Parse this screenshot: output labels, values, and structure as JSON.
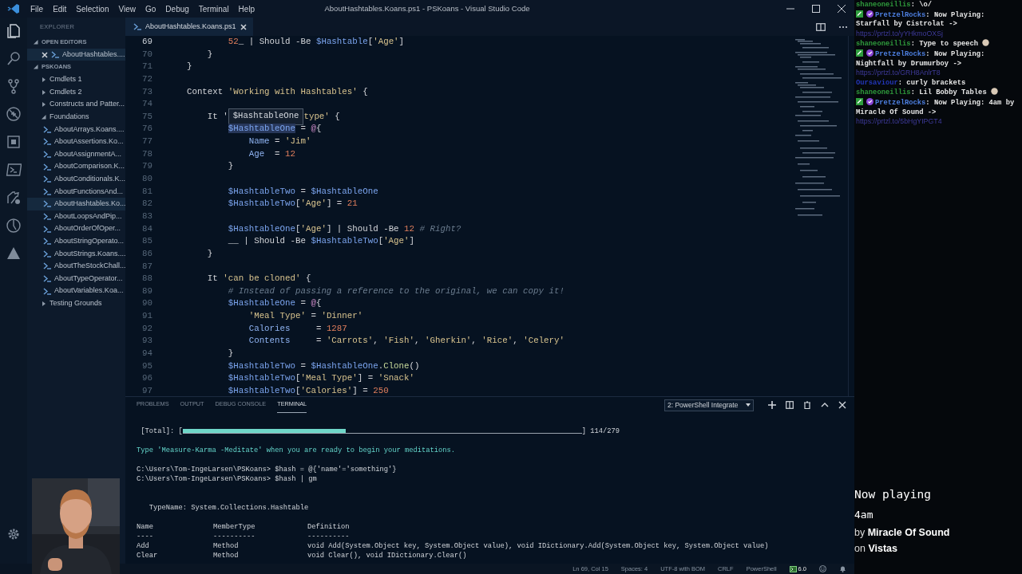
{
  "window": {
    "title": "AboutHashtables.Koans.ps1 - PSKoans - Visual Studio Code"
  },
  "menu": [
    "File",
    "Edit",
    "Selection",
    "View",
    "Go",
    "Debug",
    "Terminal",
    "Help"
  ],
  "sidebar": {
    "title": "EXPLORER",
    "sections": [
      {
        "title": "OPEN EDITORS",
        "expanded": true,
        "items": [
          {
            "label": "AboutHashtables....",
            "kind": "open-file",
            "selected": true
          }
        ]
      },
      {
        "title": "PSKOANS",
        "expanded": true,
        "items": [
          {
            "label": "Cmdlets 1",
            "kind": "folder",
            "expanded": false,
            "selected": false
          },
          {
            "label": "Cmdlets 2",
            "kind": "folder",
            "expanded": false,
            "selected": false
          },
          {
            "label": "Constructs and Patter...",
            "kind": "folder",
            "expanded": false,
            "selected": false
          },
          {
            "label": "Foundations",
            "kind": "folder",
            "expanded": true,
            "selected": false,
            "children": [
              {
                "label": "AboutArrays.Koans....",
                "kind": "file",
                "selected": false
              },
              {
                "label": "AboutAssertions.Ko...",
                "kind": "file",
                "selected": false
              },
              {
                "label": "AboutAssignmentA...",
                "kind": "file",
                "selected": false
              },
              {
                "label": "AboutComparison.K...",
                "kind": "file",
                "selected": false
              },
              {
                "label": "AboutConditionals.K...",
                "kind": "file",
                "selected": false
              },
              {
                "label": "AboutFunctionsAnd...",
                "kind": "file",
                "selected": false
              },
              {
                "label": "AboutHashtables.Ko...",
                "kind": "file",
                "selected": true
              },
              {
                "label": "AboutLoopsAndPip...",
                "kind": "file",
                "selected": false
              },
              {
                "label": "AboutOrderOfOper...",
                "kind": "file",
                "selected": false
              },
              {
                "label": "AboutStringOperato...",
                "kind": "file",
                "selected": false
              },
              {
                "label": "AboutStrings.Koans....",
                "kind": "file",
                "selected": false
              },
              {
                "label": "AboutTheStockChall...",
                "kind": "file",
                "selected": false
              },
              {
                "label": "AboutTypeOperator...",
                "kind": "file",
                "selected": false
              },
              {
                "label": "AboutVariables.Koa...",
                "kind": "file",
                "selected": false
              }
            ]
          },
          {
            "label": "Testing Grounds",
            "kind": "folder",
            "expanded": false,
            "selected": false
          }
        ]
      }
    ]
  },
  "tabs": [
    {
      "label": "AboutHashtables.Koans.ps1",
      "selected": true
    }
  ],
  "code_lines": [
    {
      "number": "69",
      "current": true,
      "tokens": [
        {
          "text": "            52",
          "kind": "num"
        },
        {
          "text": "_ | Should -Be ",
          "kind": "plain"
        },
        {
          "text": "$Hashtable",
          "kind": "var"
        },
        {
          "text": "[",
          "kind": "plain"
        },
        {
          "text": "'Age'",
          "kind": "str"
        },
        {
          "text": "]",
          "kind": "plain"
        }
      ]
    },
    {
      "number": "70",
      "current": false,
      "tokens": [
        {
          "text": "        }",
          "kind": "plain"
        }
      ]
    },
    {
      "number": "71",
      "current": false,
      "tokens": [
        {
          "text": "    }",
          "kind": "plain"
        }
      ]
    },
    {
      "number": "72",
      "current": false
    },
    {
      "number": "73",
      "current": false,
      "tokens": [
        {
          "text": "    Context ",
          "kind": "plain"
        },
        {
          "text": "'Working with Hashtables'",
          "kind": "str"
        },
        {
          "text": " {",
          "kind": "plain"
        }
      ]
    },
    {
      "number": "74",
      "current": false
    },
    {
      "number": "75",
      "current": false,
      "tokens": [
        {
          "text": "        It '",
          "kind": "plain"
        },
        {
          "text": "$HashtableOne",
          "kind": "tooltip"
        },
        {
          "text": "type'",
          "kind": "str"
        },
        {
          "text": " {",
          "kind": "plain"
        }
      ]
    },
    {
      "number": "76",
      "current": false,
      "tokens": [
        {
          "text": "            $HashtableOne",
          "kind": "selected"
        },
        {
          "text": " = ",
          "kind": "plain"
        },
        {
          "text": "@",
          "kind": "at"
        },
        {
          "text": "{",
          "kind": "plain"
        }
      ]
    },
    {
      "number": "77",
      "current": false,
      "tokens": [
        {
          "text": "                Name",
          "kind": "prop"
        },
        {
          "text": " = ",
          "kind": "plain"
        },
        {
          "text": "'Jim'",
          "kind": "str"
        }
      ]
    },
    {
      "number": "78",
      "current": false,
      "tokens": [
        {
          "text": "                Age",
          "kind": "prop"
        },
        {
          "text": "  = ",
          "kind": "plain"
        },
        {
          "text": "12",
          "kind": "num"
        }
      ]
    },
    {
      "number": "79",
      "current": false,
      "tokens": [
        {
          "text": "            }",
          "kind": "plain"
        }
      ]
    },
    {
      "number": "80",
      "current": false
    },
    {
      "number": "81",
      "current": false,
      "tokens": [
        {
          "text": "            $HashtableTwo",
          "kind": "var"
        },
        {
          "text": " = ",
          "kind": "plain"
        },
        {
          "text": "$HashtableOne",
          "kind": "var"
        }
      ]
    },
    {
      "number": "82",
      "current": false,
      "tokens": [
        {
          "text": "            $HashtableTwo",
          "kind": "var"
        },
        {
          "text": "[",
          "kind": "plain"
        },
        {
          "text": "'Age'",
          "kind": "str"
        },
        {
          "text": "] = ",
          "kind": "plain"
        },
        {
          "text": "21",
          "kind": "num"
        }
      ]
    },
    {
      "number": "83",
      "current": false
    },
    {
      "number": "84",
      "current": false,
      "tokens": [
        {
          "text": "            $HashtableOne",
          "kind": "var"
        },
        {
          "text": "[",
          "kind": "plain"
        },
        {
          "text": "'Age'",
          "kind": "str"
        },
        {
          "text": "] | Should -Be ",
          "kind": "plain"
        },
        {
          "text": "12",
          "kind": "num"
        },
        {
          "text": " # Right?",
          "kind": "comment"
        }
      ]
    },
    {
      "number": "85",
      "current": false,
      "tokens": [
        {
          "text": "            __ | Should -Be ",
          "kind": "plain"
        },
        {
          "text": "$HashtableTwo",
          "kind": "var"
        },
        {
          "text": "[",
          "kind": "plain"
        },
        {
          "text": "'Age'",
          "kind": "str"
        },
        {
          "text": "]",
          "kind": "plain"
        }
      ]
    },
    {
      "number": "86",
      "current": false,
      "tokens": [
        {
          "text": "        }",
          "kind": "plain"
        }
      ]
    },
    {
      "number": "87",
      "current": false
    },
    {
      "number": "88",
      "current": false,
      "tokens": [
        {
          "text": "        It ",
          "kind": "plain"
        },
        {
          "text": "'can be cloned'",
          "kind": "str"
        },
        {
          "text": " {",
          "kind": "plain"
        }
      ]
    },
    {
      "number": "89",
      "current": false,
      "tokens": [
        {
          "text": "            # Instead of passing a reference to the original, we can copy it!",
          "kind": "comment"
        }
      ]
    },
    {
      "number": "90",
      "current": false,
      "tokens": [
        {
          "text": "            $HashtableOne",
          "kind": "var"
        },
        {
          "text": " = ",
          "kind": "plain"
        },
        {
          "text": "@",
          "kind": "at"
        },
        {
          "text": "{",
          "kind": "plain"
        }
      ]
    },
    {
      "number": "91",
      "current": false,
      "tokens": [
        {
          "text": "                'Meal Type'",
          "kind": "str"
        },
        {
          "text": " = ",
          "kind": "plain"
        },
        {
          "text": "'Dinner'",
          "kind": "str"
        }
      ]
    },
    {
      "number": "92",
      "current": false,
      "tokens": [
        {
          "text": "                Calories",
          "kind": "prop"
        },
        {
          "text": "     = ",
          "kind": "plain"
        },
        {
          "text": "1287",
          "kind": "num"
        }
      ]
    },
    {
      "number": "93",
      "current": false,
      "tokens": [
        {
          "text": "                Contents",
          "kind": "prop"
        },
        {
          "text": "     = ",
          "kind": "plain"
        },
        {
          "text": "'Carrots'",
          "kind": "str"
        },
        {
          "text": ", ",
          "kind": "plain"
        },
        {
          "text": "'Fish'",
          "kind": "str"
        },
        {
          "text": ", ",
          "kind": "plain"
        },
        {
          "text": "'Gherkin'",
          "kind": "str"
        },
        {
          "text": ", ",
          "kind": "plain"
        },
        {
          "text": "'Rice'",
          "kind": "str"
        },
        {
          "text": ", ",
          "kind": "plain"
        },
        {
          "text": "'Celery'",
          "kind": "str"
        }
      ]
    },
    {
      "number": "94",
      "current": false,
      "tokens": [
        {
          "text": "            }",
          "kind": "plain"
        }
      ]
    },
    {
      "number": "95",
      "current": false,
      "tokens": [
        {
          "text": "            $HashtableTwo",
          "kind": "var"
        },
        {
          "text": " = ",
          "kind": "plain"
        },
        {
          "text": "$HashtableOne",
          "kind": "var"
        },
        {
          "text": ".",
          "kind": "plain"
        },
        {
          "text": "Clone",
          "kind": "fn"
        },
        {
          "text": "()",
          "kind": "plain"
        }
      ]
    },
    {
      "number": "96",
      "current": false,
      "tokens": [
        {
          "text": "            $HashtableTwo",
          "kind": "var"
        },
        {
          "text": "[",
          "kind": "plain"
        },
        {
          "text": "'Meal Type'",
          "kind": "str"
        },
        {
          "text": "] = ",
          "kind": "plain"
        },
        {
          "text": "'Snack'",
          "kind": "str"
        }
      ]
    },
    {
      "number": "97",
      "current": false,
      "tokens": [
        {
          "text": "            $HashtableTwo",
          "kind": "var"
        },
        {
          "text": "[",
          "kind": "plain"
        },
        {
          "text": "'Calories'",
          "kind": "str"
        },
        {
          "text": "] = ",
          "kind": "plain"
        },
        {
          "text": "250",
          "kind": "num"
        }
      ]
    }
  ],
  "panel": {
    "tabs": [
      {
        "label": "PROBLEMS",
        "selected": false
      },
      {
        "label": "OUTPUT",
        "selected": false
      },
      {
        "label": "DEBUG CONSOLE",
        "selected": false
      },
      {
        "label": "TERMINAL",
        "selected": true
      }
    ],
    "terminal_select": "2: PowerShell Integrate",
    "terminal": {
      "progress": {
        "label": "[Total]: [",
        "level": 0.408,
        "reading": "] 114/279"
      },
      "message": "Type 'Measure-Karma -Meditate' when you are ready to begin your meditations.",
      "commands": [
        "C:\\Users\\Tom-IngeLarsen\\PSKoans> $hash = @{'name'='something'}",
        "C:\\Users\\Tom-IngeLarsen\\PSKoans> $hash | gm"
      ],
      "typename": "TypeName: System.Collections.Hashtable",
      "table": {
        "columns": [
          "Name",
          "MemberType",
          "Definition"
        ],
        "rules": [
          "----",
          "----------",
          "----------"
        ],
        "rows": [
          [
            "Add",
            "Method",
            "void Add(System.Object key, System.Object value), void IDictionary.Add(System.Object key, System.Object value)"
          ],
          [
            "Clear",
            "Method",
            "void Clear(), void IDictionary.Clear()"
          ]
        ]
      }
    }
  },
  "status_bar": [
    {
      "text": "Ln 69, Col 15",
      "kind": "text"
    },
    {
      "text": "Spaces: 4",
      "kind": "text"
    },
    {
      "text": "UTF-8 with BOM",
      "kind": "text"
    },
    {
      "text": "CRLF",
      "kind": "text"
    },
    {
      "text": "PowerShell",
      "kind": "text"
    },
    {
      "text": "6.0",
      "kind": "version"
    }
  ],
  "chat": [
    {
      "user": "shaneoneillis",
      "color": "#2f9a3c",
      "badges": false,
      "emoji": false,
      "text": ": \\o/"
    },
    {
      "user": "PretzelRocks",
      "color": "#4d7fe0",
      "badges": true,
      "emoji": false,
      "text": ": Now Playing: Starfall by Cistrolat -> ",
      "link": "https://prtzl.to/yYHkmoOXSj"
    },
    {
      "user": "shaneoneillis",
      "color": "#2f9a3c",
      "badges": false,
      "text": ": Type to speech ",
      "emoji": true
    },
    {
      "user": "PretzelRocks",
      "color": "#4d7fe0",
      "badges": true,
      "emoji": false,
      "text": ": Now Playing: Nightfall by Drumurboy -> ",
      "link": "https://prtzl.to/GRH8AnlrT8"
    },
    {
      "user": "Oursaviour",
      "color": "#2336b8",
      "badges": false,
      "emoji": false,
      "text": ": curly brackets"
    },
    {
      "user": "shaneoneillis",
      "color": "#2f9a3c",
      "badges": false,
      "text": ": Lil Bobby Tables ",
      "emoji": true
    },
    {
      "user": "PretzelRocks",
      "color": "#4d7fe0",
      "badges": true,
      "emoji": false,
      "text": ": Now Playing: 4am by Miracle Of Sound -> ",
      "link": "https://prtzl.to/5bHgYIPGT4"
    }
  ],
  "now_playing": {
    "heading": "Now playing",
    "track": "4am",
    "artist": "by **Miracle Of Sound**",
    "album": "on **Vistas**"
  }
}
